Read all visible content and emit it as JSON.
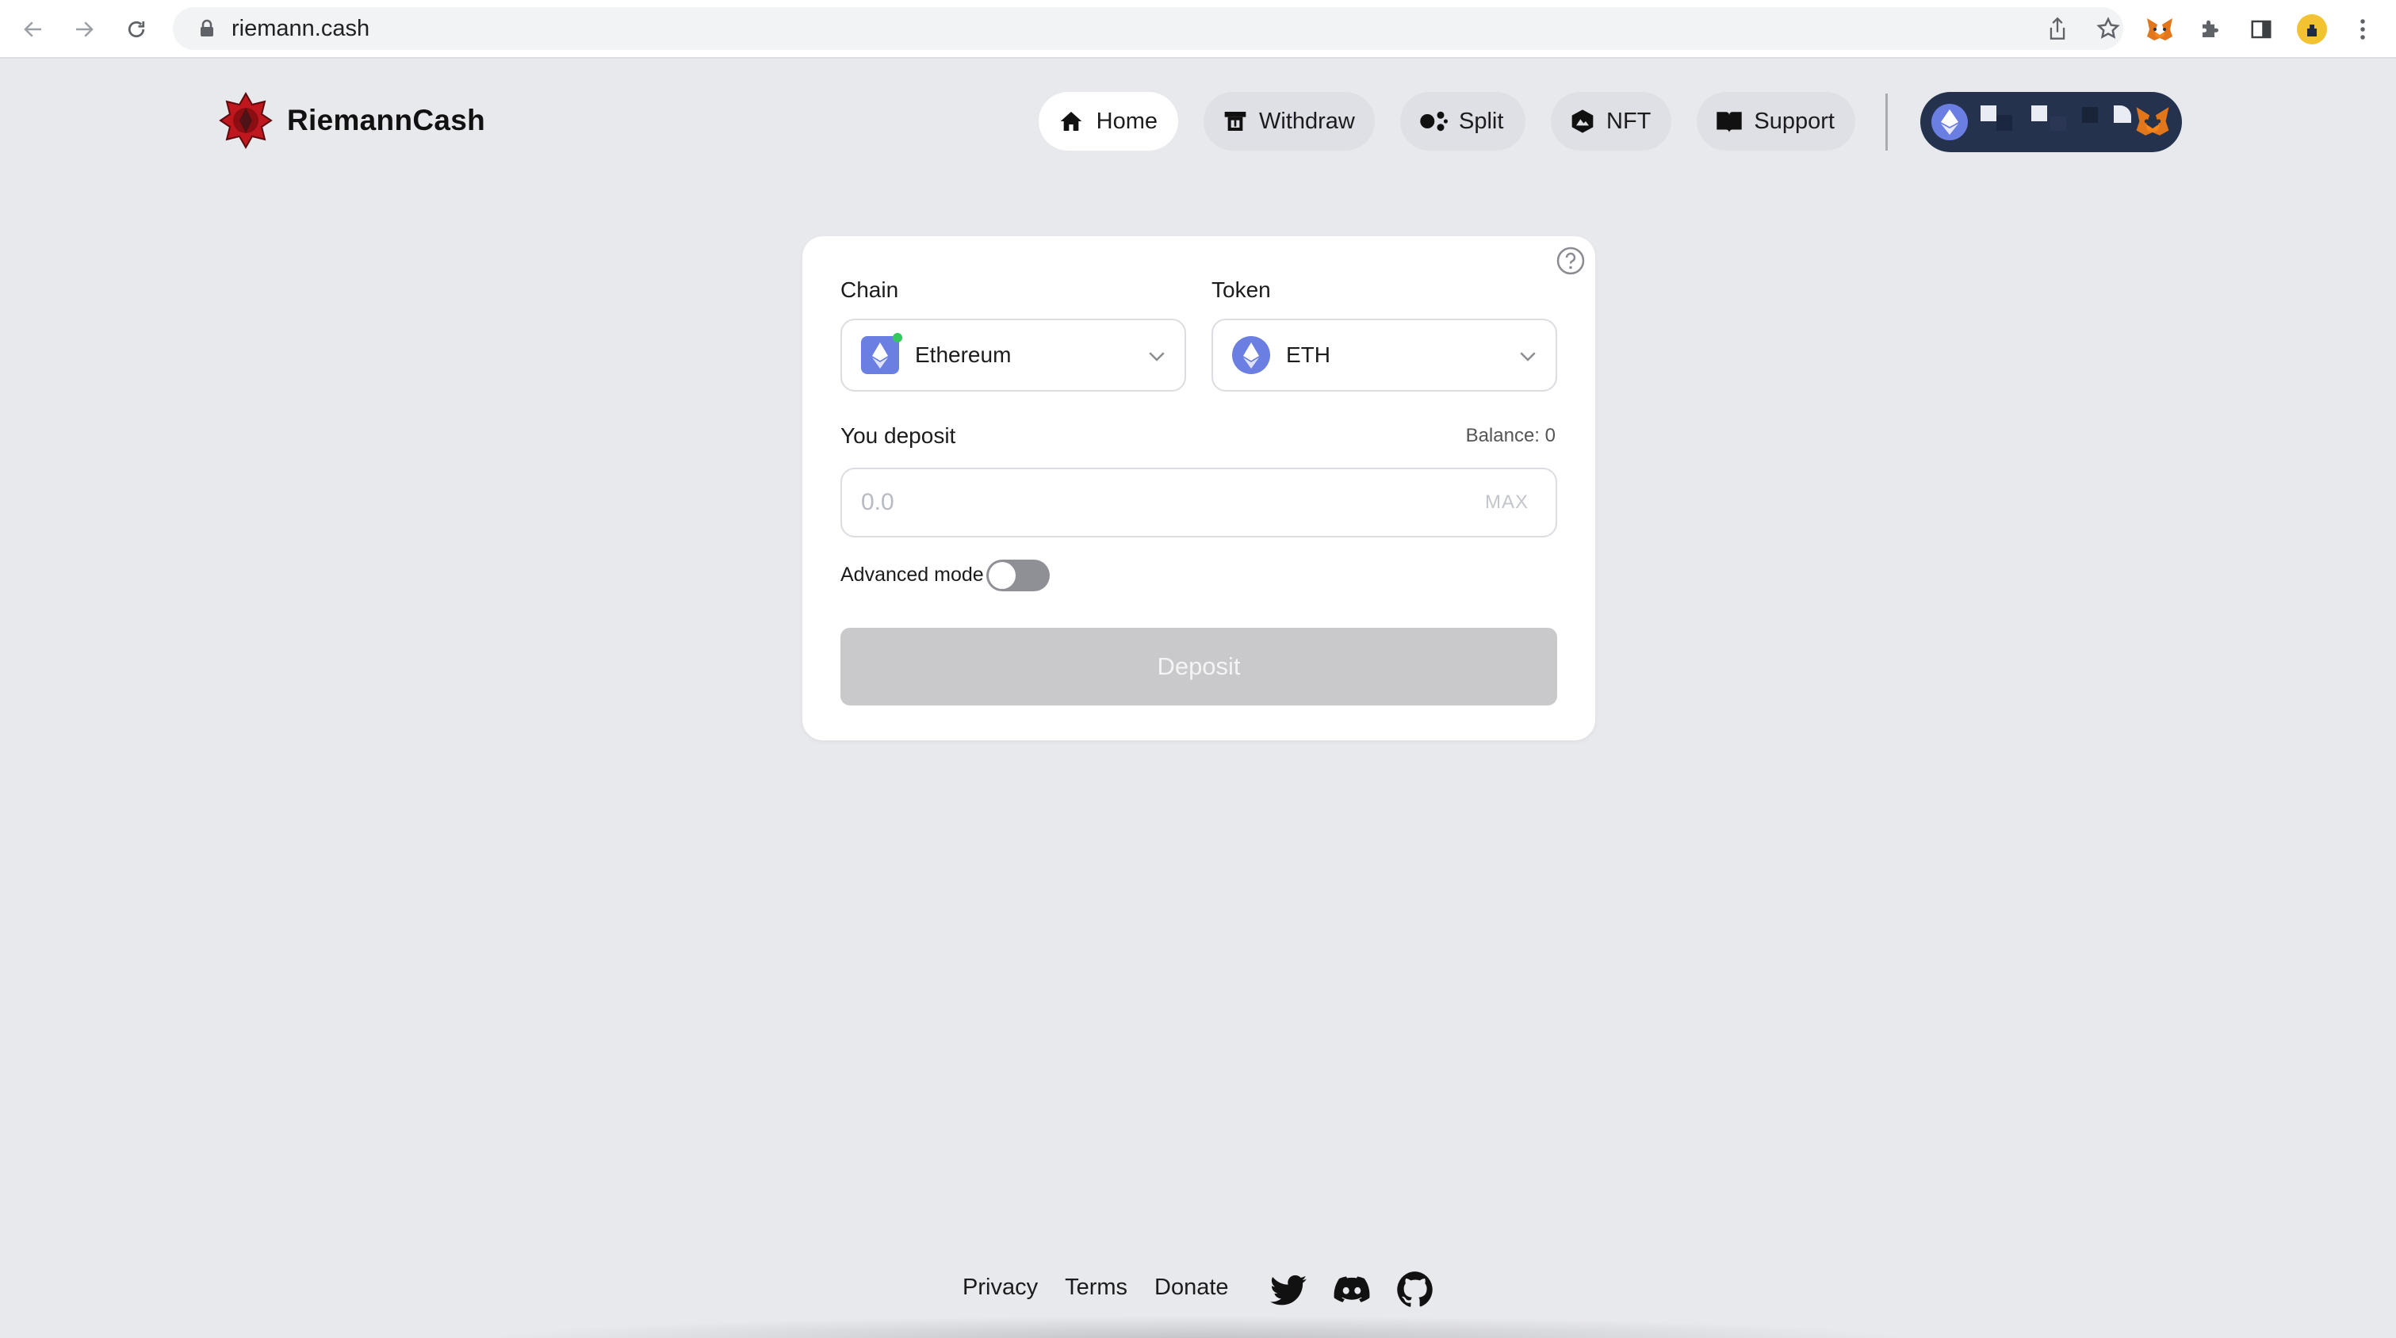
{
  "browser": {
    "url": "riemann.cash"
  },
  "header": {
    "brand": "RiemannCash",
    "nav": [
      {
        "label": "Home",
        "icon": "home-icon",
        "active": true
      },
      {
        "label": "Withdraw",
        "icon": "withdraw-icon",
        "active": false
      },
      {
        "label": "Split",
        "icon": "split-icon",
        "active": false
      },
      {
        "label": "NFT",
        "icon": "nft-icon",
        "active": false
      },
      {
        "label": "Support",
        "icon": "book-icon",
        "active": false
      }
    ]
  },
  "form": {
    "chain_label": "Chain",
    "chain_value": "Ethereum",
    "token_label": "Token",
    "token_value": "ETH",
    "deposit_label": "You deposit",
    "balance_text": "Balance: 0",
    "amount_placeholder": "0.0",
    "max_label": "MAX",
    "advanced_label": "Advanced mode",
    "advanced_enabled": false,
    "submit_label": "Deposit"
  },
  "footer": {
    "links": [
      "Privacy",
      "Terms",
      "Donate"
    ],
    "social": [
      "twitter-icon",
      "discord-icon",
      "github-icon"
    ]
  },
  "colors": {
    "page_bg": "#e8e9ed",
    "wallet_bg": "#24324d",
    "eth_purple": "#6b7fe3",
    "logo_red": "#c0171e",
    "disabled_button": "#c9c9cb"
  }
}
